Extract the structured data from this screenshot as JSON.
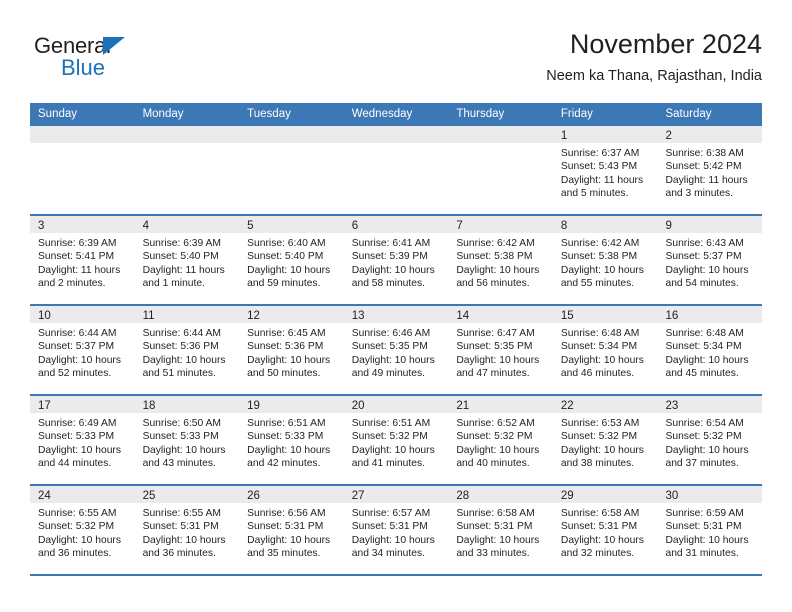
{
  "logo": {
    "word_top": "General",
    "word_bottom": "Blue",
    "triangle_color": "#1c72b8"
  },
  "header": {
    "title": "November 2024",
    "subtitle": "Neem ka Thana, Rajasthan, India"
  },
  "theme": {
    "header_blue": "#3c78b5",
    "day_band_gray": "#ebebeb",
    "text": "#231f20"
  },
  "weekdays": [
    "Sunday",
    "Monday",
    "Tuesday",
    "Wednesday",
    "Thursday",
    "Friday",
    "Saturday"
  ],
  "weeks": [
    [
      {
        "day": "",
        "empty": true
      },
      {
        "day": "",
        "empty": true
      },
      {
        "day": "",
        "empty": true
      },
      {
        "day": "",
        "empty": true
      },
      {
        "day": "",
        "empty": true
      },
      {
        "day": "1",
        "sunrise": "Sunrise: 6:37 AM",
        "sunset": "Sunset: 5:43 PM",
        "daylight": "Daylight: 11 hours and 5 minutes."
      },
      {
        "day": "2",
        "sunrise": "Sunrise: 6:38 AM",
        "sunset": "Sunset: 5:42 PM",
        "daylight": "Daylight: 11 hours and 3 minutes."
      }
    ],
    [
      {
        "day": "3",
        "sunrise": "Sunrise: 6:39 AM",
        "sunset": "Sunset: 5:41 PM",
        "daylight": "Daylight: 11 hours and 2 minutes."
      },
      {
        "day": "4",
        "sunrise": "Sunrise: 6:39 AM",
        "sunset": "Sunset: 5:40 PM",
        "daylight": "Daylight: 11 hours and 1 minute."
      },
      {
        "day": "5",
        "sunrise": "Sunrise: 6:40 AM",
        "sunset": "Sunset: 5:40 PM",
        "daylight": "Daylight: 10 hours and 59 minutes."
      },
      {
        "day": "6",
        "sunrise": "Sunrise: 6:41 AM",
        "sunset": "Sunset: 5:39 PM",
        "daylight": "Daylight: 10 hours and 58 minutes."
      },
      {
        "day": "7",
        "sunrise": "Sunrise: 6:42 AM",
        "sunset": "Sunset: 5:38 PM",
        "daylight": "Daylight: 10 hours and 56 minutes."
      },
      {
        "day": "8",
        "sunrise": "Sunrise: 6:42 AM",
        "sunset": "Sunset: 5:38 PM",
        "daylight": "Daylight: 10 hours and 55 minutes."
      },
      {
        "day": "9",
        "sunrise": "Sunrise: 6:43 AM",
        "sunset": "Sunset: 5:37 PM",
        "daylight": "Daylight: 10 hours and 54 minutes."
      }
    ],
    [
      {
        "day": "10",
        "sunrise": "Sunrise: 6:44 AM",
        "sunset": "Sunset: 5:37 PM",
        "daylight": "Daylight: 10 hours and 52 minutes."
      },
      {
        "day": "11",
        "sunrise": "Sunrise: 6:44 AM",
        "sunset": "Sunset: 5:36 PM",
        "daylight": "Daylight: 10 hours and 51 minutes."
      },
      {
        "day": "12",
        "sunrise": "Sunrise: 6:45 AM",
        "sunset": "Sunset: 5:36 PM",
        "daylight": "Daylight: 10 hours and 50 minutes."
      },
      {
        "day": "13",
        "sunrise": "Sunrise: 6:46 AM",
        "sunset": "Sunset: 5:35 PM",
        "daylight": "Daylight: 10 hours and 49 minutes."
      },
      {
        "day": "14",
        "sunrise": "Sunrise: 6:47 AM",
        "sunset": "Sunset: 5:35 PM",
        "daylight": "Daylight: 10 hours and 47 minutes."
      },
      {
        "day": "15",
        "sunrise": "Sunrise: 6:48 AM",
        "sunset": "Sunset: 5:34 PM",
        "daylight": "Daylight: 10 hours and 46 minutes."
      },
      {
        "day": "16",
        "sunrise": "Sunrise: 6:48 AM",
        "sunset": "Sunset: 5:34 PM",
        "daylight": "Daylight: 10 hours and 45 minutes."
      }
    ],
    [
      {
        "day": "17",
        "sunrise": "Sunrise: 6:49 AM",
        "sunset": "Sunset: 5:33 PM",
        "daylight": "Daylight: 10 hours and 44 minutes."
      },
      {
        "day": "18",
        "sunrise": "Sunrise: 6:50 AM",
        "sunset": "Sunset: 5:33 PM",
        "daylight": "Daylight: 10 hours and 43 minutes."
      },
      {
        "day": "19",
        "sunrise": "Sunrise: 6:51 AM",
        "sunset": "Sunset: 5:33 PM",
        "daylight": "Daylight: 10 hours and 42 minutes."
      },
      {
        "day": "20",
        "sunrise": "Sunrise: 6:51 AM",
        "sunset": "Sunset: 5:32 PM",
        "daylight": "Daylight: 10 hours and 41 minutes."
      },
      {
        "day": "21",
        "sunrise": "Sunrise: 6:52 AM",
        "sunset": "Sunset: 5:32 PM",
        "daylight": "Daylight: 10 hours and 40 minutes."
      },
      {
        "day": "22",
        "sunrise": "Sunrise: 6:53 AM",
        "sunset": "Sunset: 5:32 PM",
        "daylight": "Daylight: 10 hours and 38 minutes."
      },
      {
        "day": "23",
        "sunrise": "Sunrise: 6:54 AM",
        "sunset": "Sunset: 5:32 PM",
        "daylight": "Daylight: 10 hours and 37 minutes."
      }
    ],
    [
      {
        "day": "24",
        "sunrise": "Sunrise: 6:55 AM",
        "sunset": "Sunset: 5:32 PM",
        "daylight": "Daylight: 10 hours and 36 minutes."
      },
      {
        "day": "25",
        "sunrise": "Sunrise: 6:55 AM",
        "sunset": "Sunset: 5:31 PM",
        "daylight": "Daylight: 10 hours and 36 minutes."
      },
      {
        "day": "26",
        "sunrise": "Sunrise: 6:56 AM",
        "sunset": "Sunset: 5:31 PM",
        "daylight": "Daylight: 10 hours and 35 minutes."
      },
      {
        "day": "27",
        "sunrise": "Sunrise: 6:57 AM",
        "sunset": "Sunset: 5:31 PM",
        "daylight": "Daylight: 10 hours and 34 minutes."
      },
      {
        "day": "28",
        "sunrise": "Sunrise: 6:58 AM",
        "sunset": "Sunset: 5:31 PM",
        "daylight": "Daylight: 10 hours and 33 minutes."
      },
      {
        "day": "29",
        "sunrise": "Sunrise: 6:58 AM",
        "sunset": "Sunset: 5:31 PM",
        "daylight": "Daylight: 10 hours and 32 minutes."
      },
      {
        "day": "30",
        "sunrise": "Sunrise: 6:59 AM",
        "sunset": "Sunset: 5:31 PM",
        "daylight": "Daylight: 10 hours and 31 minutes."
      }
    ]
  ]
}
